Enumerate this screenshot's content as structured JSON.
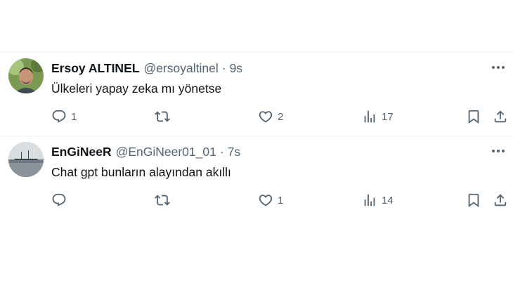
{
  "tweets": [
    {
      "display_name": "Ersoy ALTINEL",
      "handle": "@ersoyaltinel",
      "separator": "·",
      "time": "9s",
      "text": "Ülkeleri yapay zeka mı yönetse",
      "replies": "1",
      "retweets": "",
      "likes": "2",
      "views": "17"
    },
    {
      "display_name": "EnGiNeeR",
      "handle": "@EnGiNeer01_01",
      "separator": "·",
      "time": "7s",
      "text": "Chat gpt bunların alayından akıllı",
      "replies": "",
      "retweets": "",
      "likes": "1",
      "views": "14"
    }
  ],
  "colors": {
    "text_primary": "#0f1419",
    "text_secondary": "#536471",
    "divider": "#eff3f4"
  },
  "icons": [
    "reply-icon",
    "retweet-icon",
    "like-icon",
    "views-icon",
    "bookmark-icon",
    "share-icon",
    "more-icon"
  ]
}
